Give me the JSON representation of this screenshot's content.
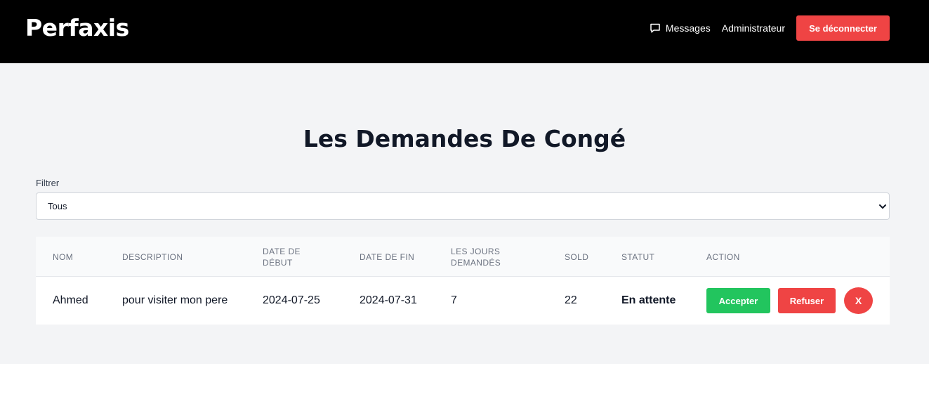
{
  "navbar": {
    "brand": "Perfaxis",
    "messages_label": "Messages",
    "messages_icon": "chat-bubble-icon",
    "admin_label": "Administrateur",
    "logout_label": "Se déconnecter"
  },
  "page": {
    "title": "Les Demandes De Congé"
  },
  "filter": {
    "label": "Filtrer",
    "selected": "Tous"
  },
  "table": {
    "headers": {
      "nom": "Nom",
      "description": "Description",
      "date_debut": "Date de début",
      "date_fin": "Date de fin",
      "jours": "Les jours demandés",
      "sold": "Sold",
      "statut": "Statut",
      "action": "Action"
    },
    "rows": [
      {
        "nom": "Ahmed",
        "description": "pour visiter mon pere",
        "date_debut": "2024-07-25",
        "date_fin": "2024-07-31",
        "jours": "7",
        "sold": "22",
        "statut": "En attente"
      }
    ],
    "actions": {
      "accept_label": "Accepter",
      "refuse_label": "Refuser",
      "close_label": "X"
    }
  },
  "colors": {
    "navbar_bg": "#000000",
    "danger": "#ef4444",
    "success": "#22c55e",
    "page_bg": "#f3f4f6"
  }
}
